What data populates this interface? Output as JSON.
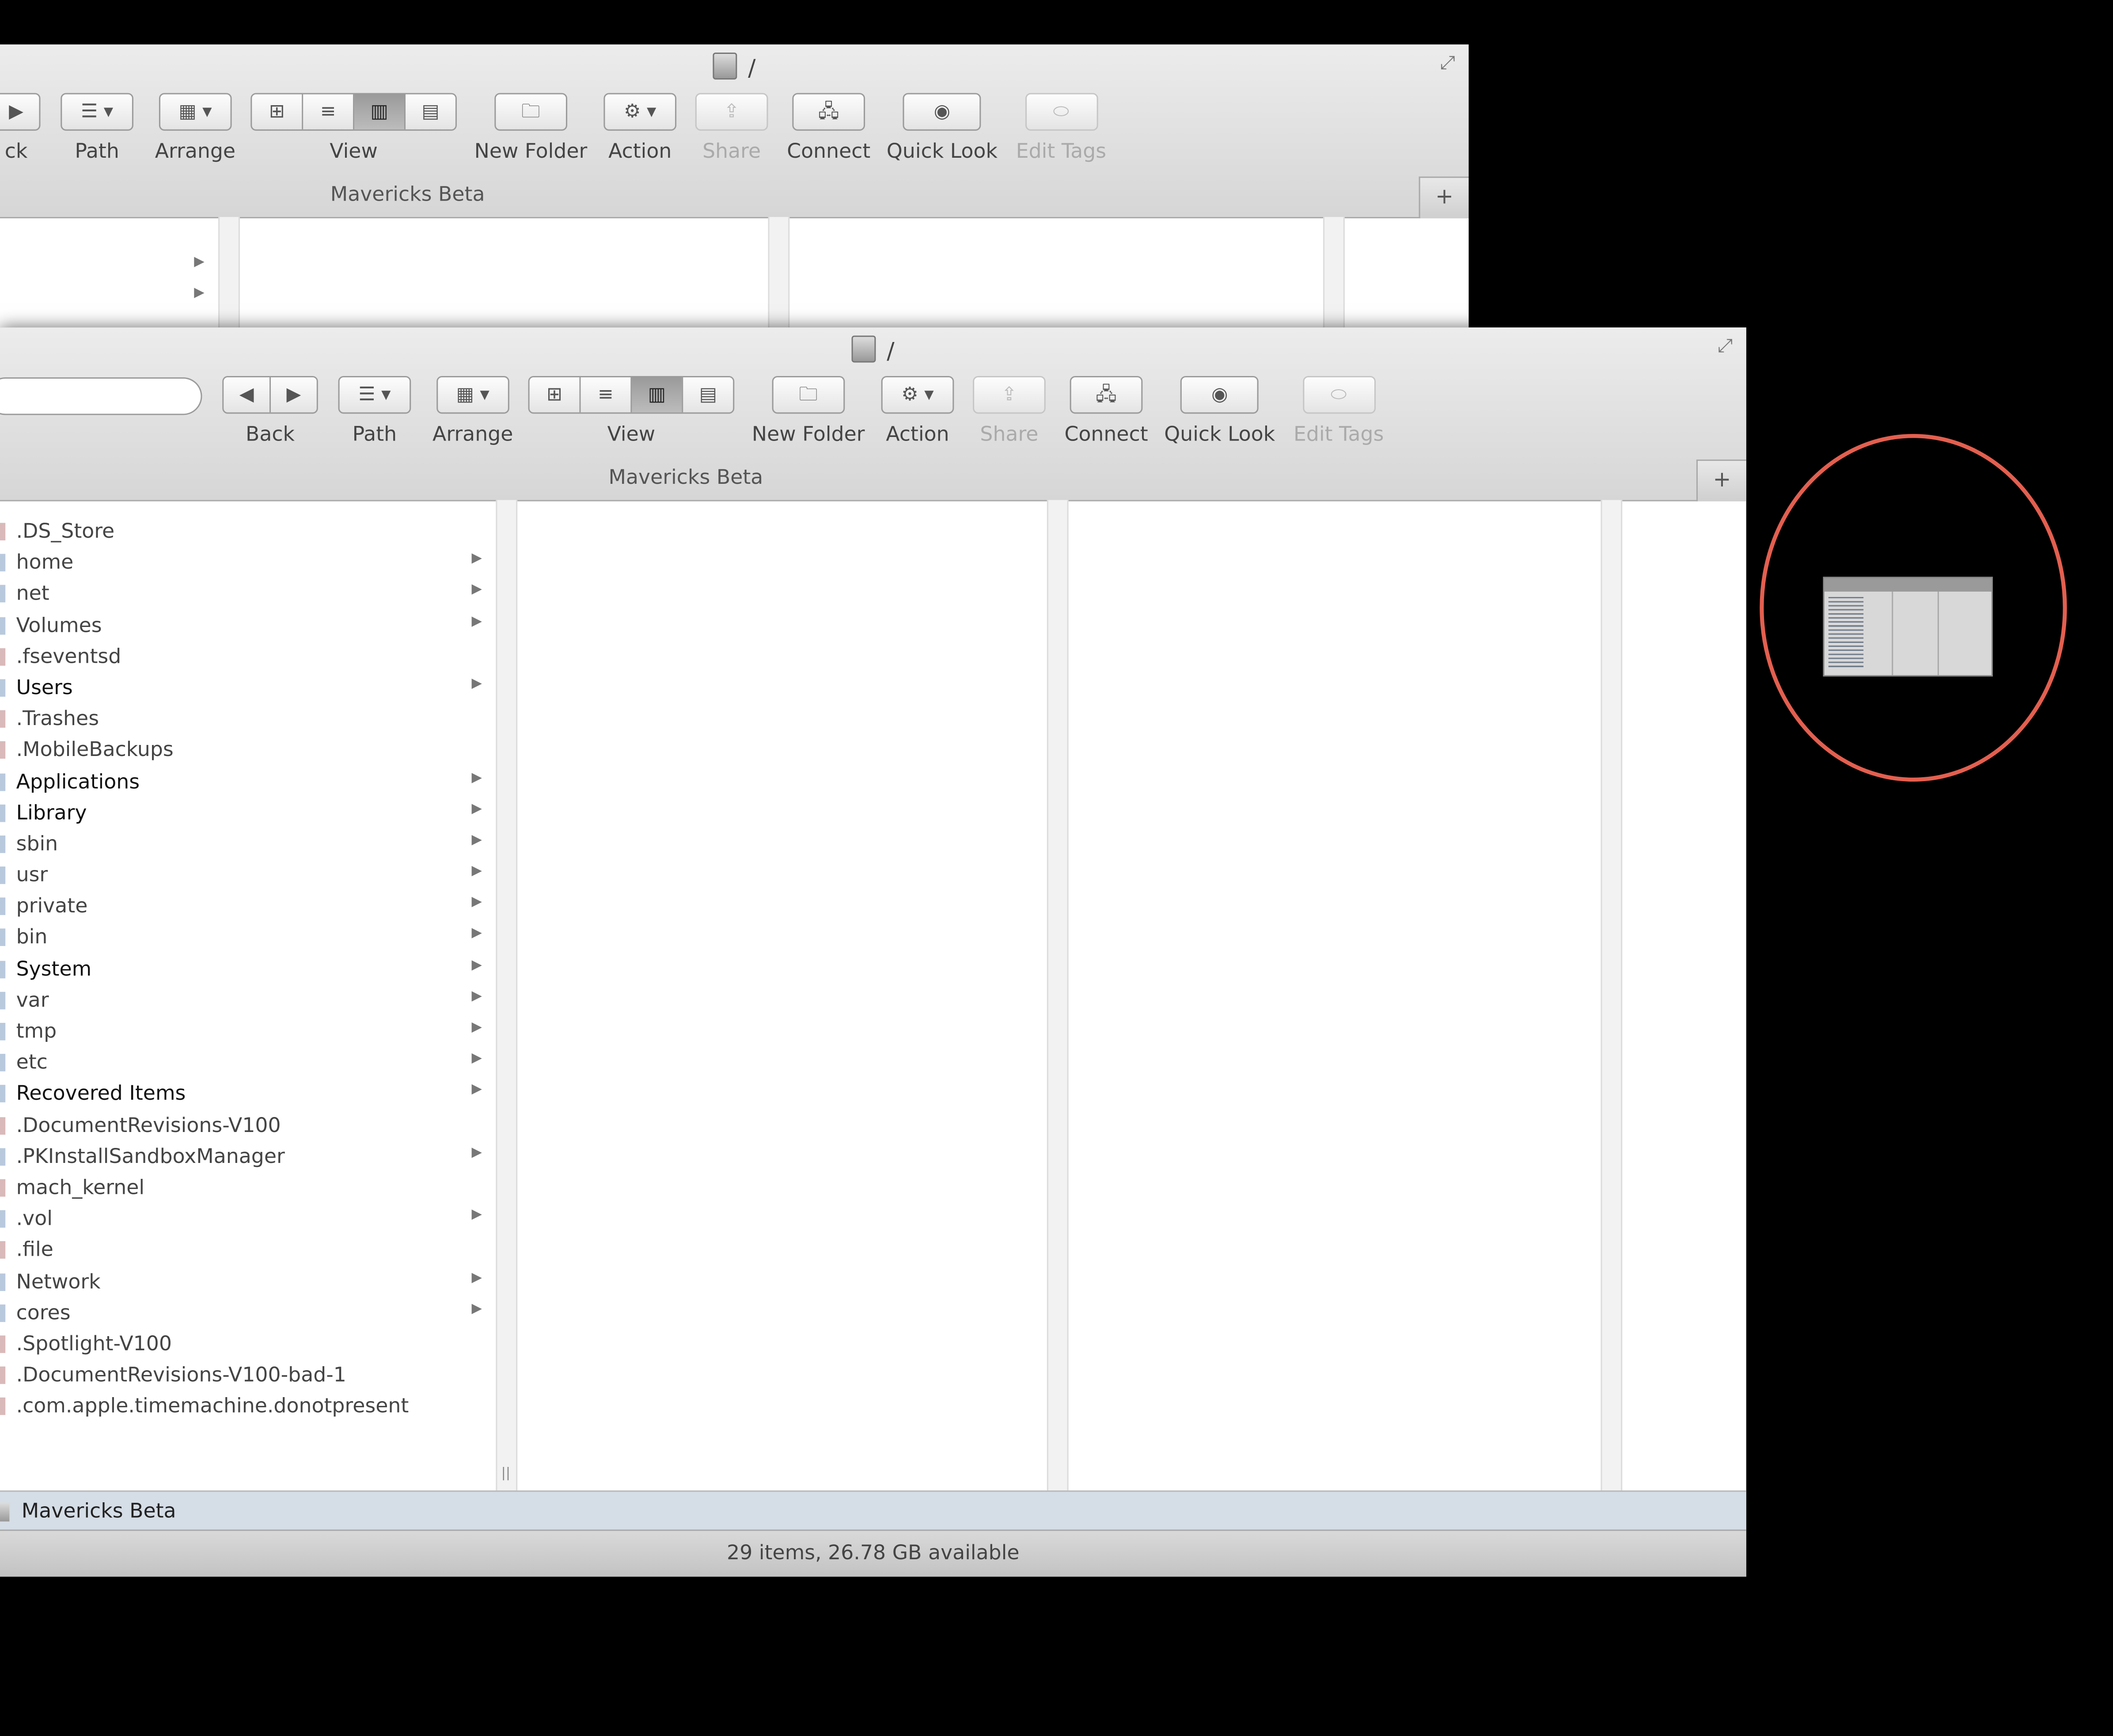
{
  "window": {
    "title": "/",
    "volume_name": "Mavericks Beta",
    "tab_add_label": "+"
  },
  "toolbar": {
    "back_label": "Back",
    "path_label": "Path",
    "arrange_label": "Arrange",
    "view_label": "View",
    "new_folder_label": "New Folder",
    "action_label": "Action",
    "share_label": "Share",
    "connect_label": "Connect",
    "quick_look_label": "Quick Look",
    "edit_tags_label": "Edit Tags"
  },
  "back_window": {
    "back_partial_label": "ck"
  },
  "files": [
    {
      "name": ".DS_Store"
    },
    {
      "name": "home"
    },
    {
      "name": "net"
    },
    {
      "name": "Volumes"
    },
    {
      "name": ".fseventsd"
    },
    {
      "name": "Users"
    },
    {
      "name": ".Trashes"
    },
    {
      "name": ".MobileBackups"
    },
    {
      "name": "Applications"
    },
    {
      "name": "Library"
    },
    {
      "name": "sbin"
    },
    {
      "name": "usr"
    },
    {
      "name": "private"
    },
    {
      "name": "bin"
    },
    {
      "name": "System"
    },
    {
      "name": "var"
    },
    {
      "name": "tmp"
    },
    {
      "name": "etc"
    },
    {
      "name": "Recovered Items"
    },
    {
      "name": ".DocumentRevisions-V100"
    },
    {
      "name": ".PKInstallSandboxManager"
    },
    {
      "name": "mach_kernel"
    },
    {
      "name": ".vol"
    },
    {
      "name": ".file"
    },
    {
      "name": "Network"
    },
    {
      "name": "cores"
    },
    {
      "name": ".Spotlight-V100"
    },
    {
      "name": ".DocumentRevisions-V100-bad-1"
    },
    {
      "name": ".com.apple.timemachine.donotpresent"
    }
  ],
  "status": {
    "path_bar_label": "Mavericks Beta",
    "summary": "29 items, 26.78 GB available"
  },
  "colors": {
    "highlight_circle": "#e35f4f"
  }
}
